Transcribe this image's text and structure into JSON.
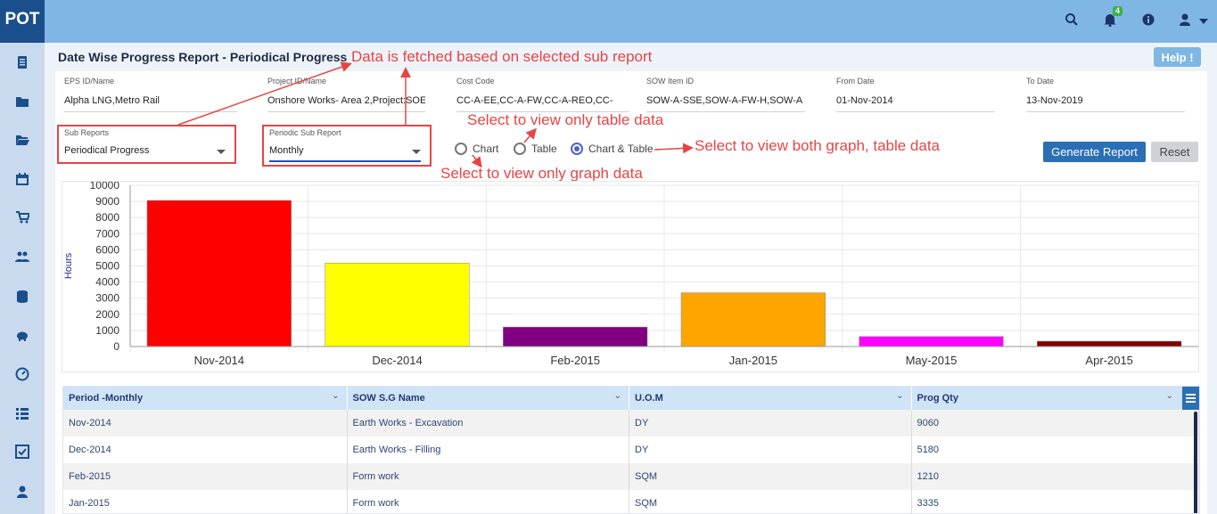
{
  "app": {
    "logo": "POT",
    "notification_count": "4"
  },
  "sidebar_icons": [
    "report-icon",
    "folder-icon",
    "folder-open-icon",
    "calendar-icon",
    "cart-icon",
    "users-icon",
    "database-icon",
    "piggy-bank-icon",
    "dashboard-icon",
    "list-icon",
    "checklist-icon",
    "user-icon"
  ],
  "topbar_icons": [
    "search-icon",
    "bell-icon",
    "info-icon",
    "user-icon",
    "caret-down-icon"
  ],
  "page": {
    "title": "Date Wise Progress Report - Periodical Progress",
    "help_label": "Help !"
  },
  "filters": {
    "eps": {
      "label": "EPS ID/Name",
      "value": "Alpha LNG,Metro Rail"
    },
    "project": {
      "label": "Project ID/Name",
      "value": "Onshore  Works- Area 2,Project:SOE"
    },
    "cost_code": {
      "label": "Cost Code",
      "value": "CC-A-EE,CC-A-FW,CC-A-REO,CC-"
    },
    "sow_item": {
      "label": "SOW Item ID",
      "value": "SOW-A-SSE,SOW-A-FW-H,SOW-A"
    },
    "from_date": {
      "label": "From Date",
      "value": "01-Nov-2014"
    },
    "to_date": {
      "label": "To Date",
      "value": "13-Nov-2019"
    },
    "sub_reports": {
      "label": "Sub Reports",
      "value": "Periodical Progress"
    },
    "periodic_sub_report": {
      "label": "Periodic Sub Report",
      "value": "Monthly"
    }
  },
  "view_options": {
    "chart": "Chart",
    "table": "Table",
    "chart_table": "Chart & Table",
    "selected": "chart_table"
  },
  "buttons": {
    "generate": "Generate Report",
    "reset": "Reset"
  },
  "annotations": {
    "fetched": "Data is fetched based on selected sub report",
    "table_only": "Select to view only table data",
    "both": "Select to view both graph, table data",
    "graph_only": "Select to view only graph data"
  },
  "colors": {
    "accent": "#2b6fb5",
    "annotation": "#e64545",
    "topbar": "#7fb6e4"
  },
  "chart_data": {
    "type": "bar",
    "categories": [
      "Nov-2014",
      "Dec-2014",
      "Feb-2015",
      "Jan-2015",
      "May-2015",
      "Apr-2015"
    ],
    "values": [
      9060,
      5180,
      1210,
      3335,
      620,
      330
    ],
    "colors": [
      "#ff0000",
      "#ffff00",
      "#800080",
      "#ffa500",
      "#ff00ff",
      "#800000"
    ],
    "ylabel": "Hours",
    "ylim": [
      0,
      10000
    ],
    "yticks": [
      0,
      1000,
      2000,
      3000,
      4000,
      5000,
      6000,
      7000,
      8000,
      9000,
      10000
    ],
    "grid": true
  },
  "table": {
    "columns": [
      "Period -Monthly",
      "SOW S.G Name",
      "U.O.M",
      "Prog Qty"
    ],
    "rows": [
      [
        "Nov-2014",
        "Earth Works - Excavation",
        "DY",
        "9060"
      ],
      [
        "Dec-2014",
        "Earth Works - Filling",
        "DY",
        "5180"
      ],
      [
        "Feb-2015",
        "Form work",
        "SQM",
        "1210"
      ],
      [
        "Jan-2015",
        "Form work",
        "SQM",
        "3335"
      ]
    ]
  }
}
